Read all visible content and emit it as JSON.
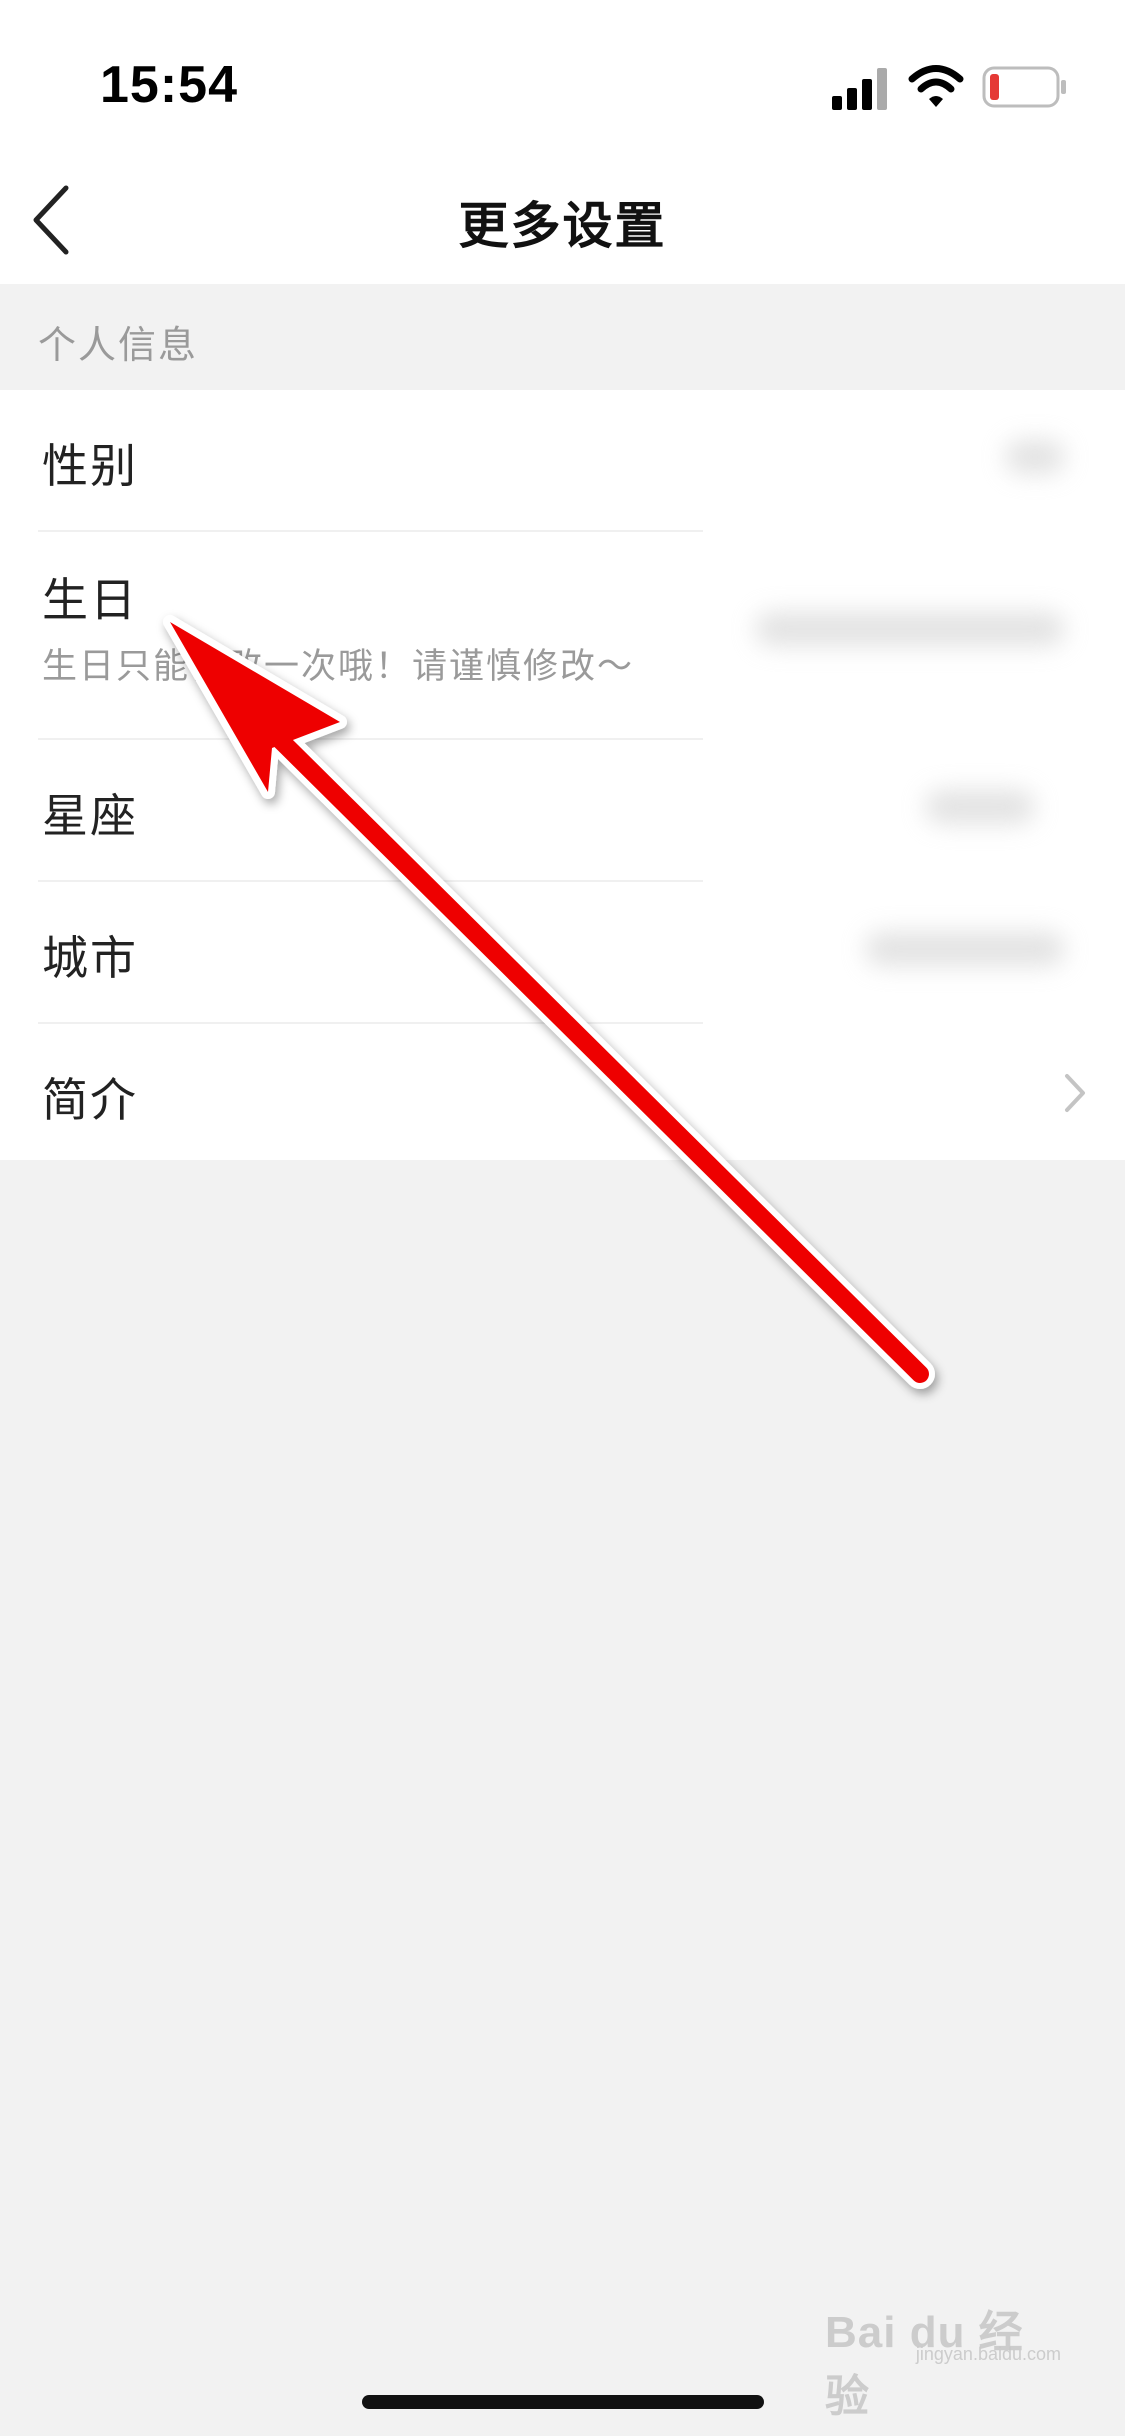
{
  "status_bar": {
    "time": "15:54",
    "icons": [
      "cellular-signal-icon",
      "wifi-icon",
      "battery-low-icon"
    ],
    "battery_color": "#e53935"
  },
  "nav": {
    "back_icon": "chevron-left-icon",
    "title": "更多设置"
  },
  "section": {
    "title": "个人信息"
  },
  "rows": [
    {
      "label": "性别",
      "value_hidden": true
    },
    {
      "label": "生日",
      "sub": "生日只能修改一次哦！请谨慎修改～",
      "value_hidden": true
    },
    {
      "label": "星座",
      "value_hidden": true
    },
    {
      "label": "城市",
      "value_hidden": true
    },
    {
      "label": "简介",
      "trailing_icon": "chevron-right-icon"
    }
  ],
  "annotation": {
    "arrow_color": "#ee0000",
    "icon": "red-arrow-icon"
  },
  "watermark": {
    "text": "Bai du 经验",
    "sub": "jingyan.baidu.com"
  },
  "colors": {
    "page_bg": "#f2f2f2",
    "card_bg": "#ffffff",
    "secondary_text": "#9a9a9a"
  }
}
